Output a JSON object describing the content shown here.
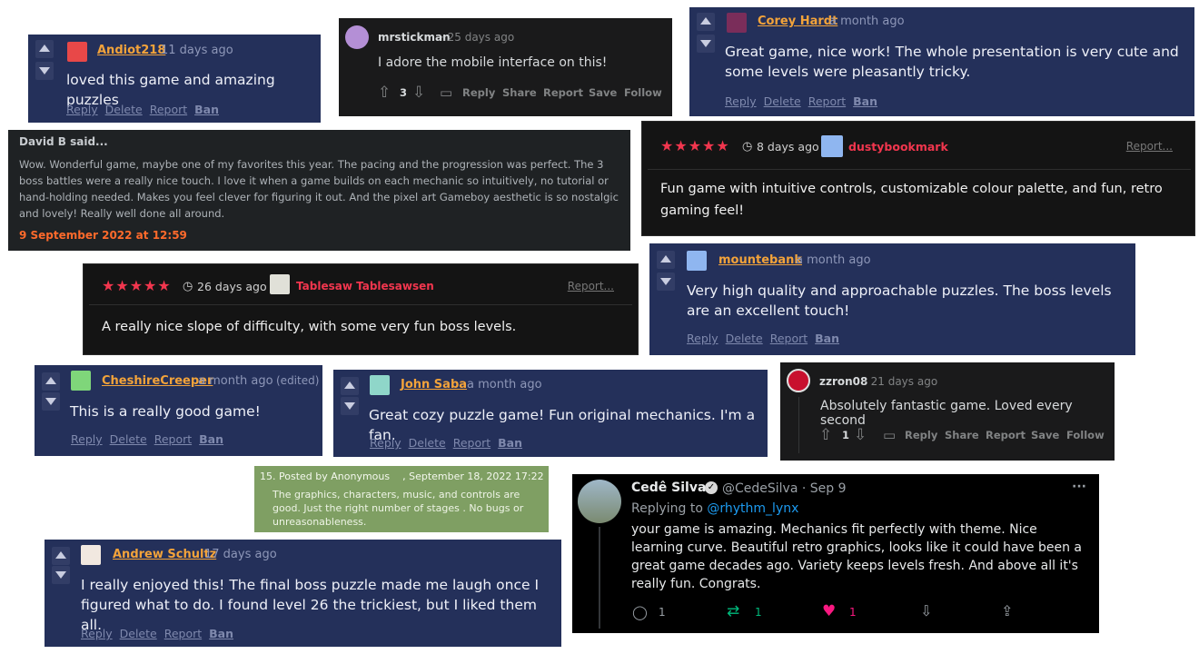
{
  "comments": {
    "andiot": {
      "name": "Andiot218",
      "time": "11 days ago",
      "body": "loved this game and amazing puzzles",
      "links": [
        "Reply",
        "Delete",
        "Report",
        "Ban"
      ]
    },
    "mrstickman": {
      "name": "mrstickman",
      "time": "· 25 days ago",
      "body": "I adore the mobile interface on this!",
      "votes": "3",
      "actions": [
        "Reply",
        "Share",
        "Report",
        "Save",
        "Follow"
      ]
    },
    "corey": {
      "name": "Corey Hardt",
      "time": "a month ago",
      "body": "Great game, nice work! The whole presentation is very cute and some levels were pleasantly tricky.",
      "links": [
        "Reply",
        "Delete",
        "Report",
        "Ban"
      ]
    },
    "davidb": {
      "header": "David B said...",
      "body": "Wow. Wonderful game, maybe one of my favorites this year. The pacing and the progression was perfect. The 3 boss battles were a really nice touch. I love it when a game builds on each mechanic so intuitively, no tutorial or hand-holding needed. Makes you feel clever for figuring it out. And the pixel art Gameboy aesthetic is so nostalgic and lovely! Really well done all around.",
      "date": "9 September 2022 at 12:59"
    },
    "dusty": {
      "stars": "★★★★★",
      "time": "8 days ago",
      "name": "dustybookmark",
      "report": "Report...",
      "body": "Fun game with intuitive controls, customizable colour palette, and fun, retro gaming feel!"
    },
    "tablesaw": {
      "stars": "★★★★★",
      "time": "26 days ago",
      "name": "Tablesaw Tablesawsen",
      "report": "Report...",
      "body": "A really nice slope of difficulty, with some very fun boss levels."
    },
    "mountebank": {
      "name": "mountebank",
      "time": "a month ago",
      "body": "Very high quality and approachable puzzles. The boss levels are an excellent touch!",
      "links": [
        "Reply",
        "Delete",
        "Report",
        "Ban"
      ]
    },
    "cheshire": {
      "name": "CheshireCreeper",
      "time": "a month ago",
      "edited": "(edited)",
      "body": "This is a really good game!",
      "links": [
        "Reply",
        "Delete",
        "Report",
        "Ban"
      ]
    },
    "johnsaba": {
      "name": "John Saba",
      "time": "a month ago",
      "body": "Great cozy puzzle game! Fun original mechanics. I'm a fan.",
      "links": [
        "Reply",
        "Delete",
        "Report",
        "Ban"
      ]
    },
    "zzron": {
      "name": "zzron08",
      "time": "· 21 days ago",
      "body": "Absolutely fantastic game. Loved every second",
      "votes": "1",
      "actions": [
        "Reply",
        "Share",
        "Report",
        "Save",
        "Follow"
      ]
    },
    "anon": {
      "header_a": "15. Posted by Anonymous",
      "header_b": ", September 18, 2022 17:22",
      "body": "The graphics, characters, music, and controls are good. Just the right number of stages . No bugs or unreasonableness."
    },
    "andrew": {
      "name": "Andrew Schultz",
      "time": "17 days ago",
      "body": "I really enjoyed this! The final boss puzzle made me laugh once I figured what to do. I found level 26 the trickiest, but I liked them all.",
      "links": [
        "Reply",
        "Delete",
        "Report",
        "Ban"
      ]
    },
    "cede": {
      "name": "Cedê Silva",
      "handle": "@CedeSilva · Sep 9",
      "replying_to": "Replying to",
      "replying_handle": "@rhythm_lynx",
      "body": "your game is amazing. Mechanics fit perfectly with theme. Nice learning curve. Beautiful retro graphics, looks like it could have been a great game decades ago. Variety keeps levels fresh. And above all it's really fun. Congrats.",
      "replies": "1",
      "retweets": "1",
      "likes": "1",
      "more": "···"
    }
  },
  "colors": {
    "navy": "#24305a",
    "accent_name": "#f3a33a",
    "star": "#f2364e",
    "date_orange": "#ff6a2b",
    "twitter_link": "#1d9bf0",
    "like": "#f91880",
    "retweet": "#00ba7c"
  }
}
